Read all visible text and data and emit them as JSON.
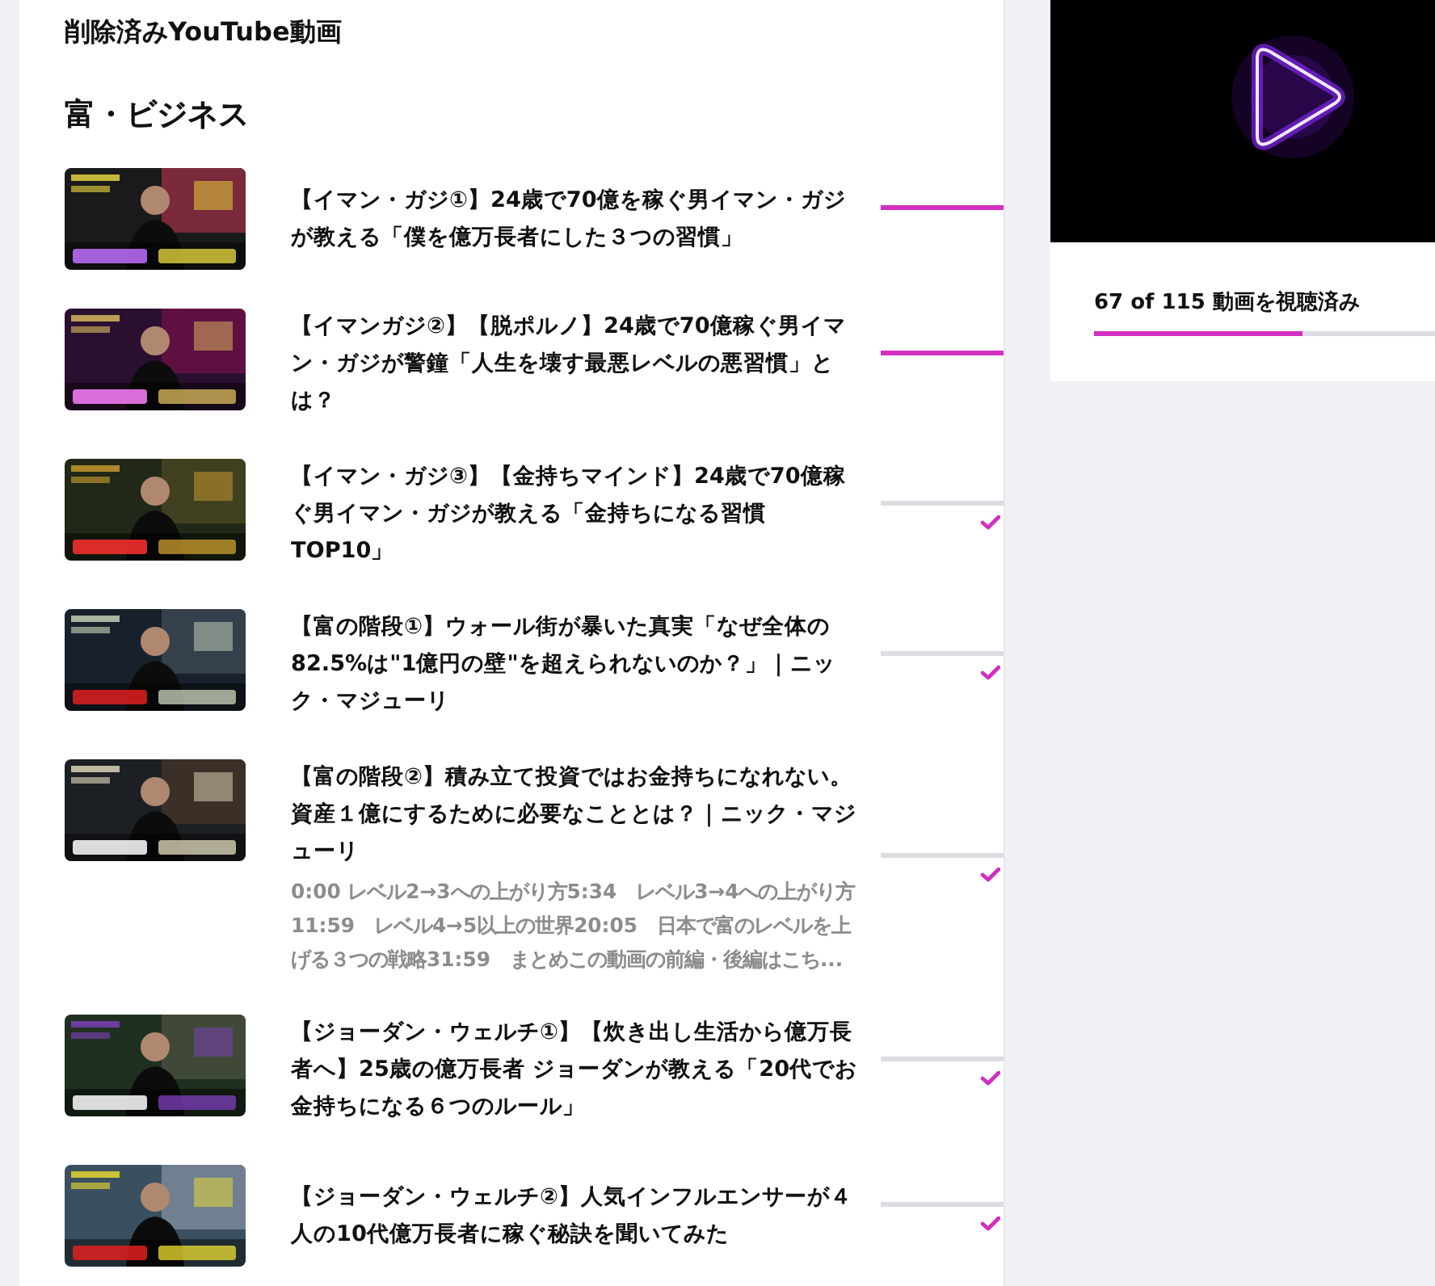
{
  "heading": "削除済みYouTube動画",
  "section": "富・ビジネス",
  "videos": [
    {
      "title": "【イマン・ガジ①】24歳で70億を稼ぐ男イマン・ガジが教える「僕を億万長者にした３つの習慣」",
      "level": 1,
      "completed": false
    },
    {
      "title": "【イマンガジ②】【脱ポルノ】24歳で70億稼ぐ男イマン・ガジが警鐘「人生を壊す最悪レベルの悪習慣」とは？",
      "level": 1,
      "completed": false
    },
    {
      "title": "【イマン・ガジ③】【金持ちマインド】24歳で70億稼ぐ男イマン・ガジが教える「金持ちになる習慣TOP10」",
      "level": 0,
      "completed": true
    },
    {
      "title": "【富の階段①】ウォール街が暴いた真実「なぜ全体の82.5%は\"1億円の壁\"を超えられないのか？」｜ニック・マジューリ",
      "level": 0,
      "completed": true
    },
    {
      "title": "【富の階段②】積み立て投資ではお金持ちになれない。資産１億にするために必要なこととは？｜ニック・マジューリ",
      "description": "0:00 レベル2→3への上がり方5:34　レベル3→4への上がり方11:59　レベル4→5以上の世界20:05　日本で富のレベルを上げる３つの戦略31:59　まとめこの動画の前編・後編はこち...",
      "level": 0,
      "completed": true
    },
    {
      "title": "【ジョーダン・ウェルチ①】【炊き出し生活から億万長者へ】25歳の億万長者 ジョーダンが教える「20代でお金持ちになる６つのルール」",
      "level": 0,
      "completed": true
    },
    {
      "title": "【ジョーダン・ウェルチ②】人気インフルエンサーが４人の10代億万長者に稼ぐ秘訣を聞いてみた",
      "level": 0,
      "completed": true
    }
  ],
  "sidebar": {
    "progress_text": "67 of 115 動画を視聴済み",
    "level": 0.58
  }
}
